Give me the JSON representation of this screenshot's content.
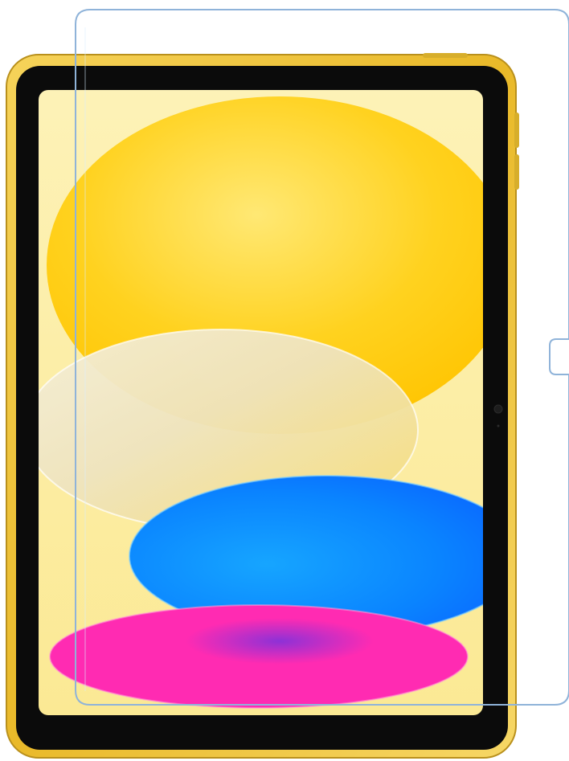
{
  "product": {
    "device": "tablet",
    "accessory": "screen-protector",
    "frame_color": "#F2C63A",
    "bezel_color": "#0B0B0B",
    "screen_background": "#FCEFA6",
    "protector_edge_color": "#8FB3D9"
  },
  "wallpaper": {
    "shapes": [
      {
        "name": "yellow-ellipse",
        "color": "#FFD21F"
      },
      {
        "name": "white-ellipse",
        "color": "#F2EAD0"
      },
      {
        "name": "blue-ellipse",
        "color": "#0A84FF"
      },
      {
        "name": "magenta-ellipse",
        "color": "#FF2BB2"
      }
    ]
  }
}
